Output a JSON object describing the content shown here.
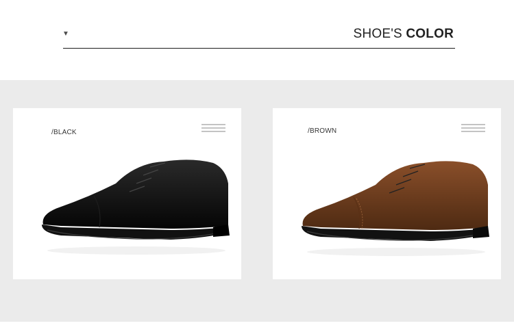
{
  "header": {
    "dropdown_icon": "triangle-down-icon",
    "title_thin": "SHOE'S",
    "title_bold": "COLOR"
  },
  "products": [
    {
      "color_label": "/BLACK",
      "menu_icon": "hamburger-icon",
      "shoe_color": "#0d0d0d"
    },
    {
      "color_label": "/BROWN",
      "menu_icon": "hamburger-icon",
      "shoe_color": "#6b3a1c"
    }
  ],
  "colors": {
    "band": "#ebebeb",
    "rule": "#1a1a1a",
    "menu_lines": "#c3c3c3"
  }
}
